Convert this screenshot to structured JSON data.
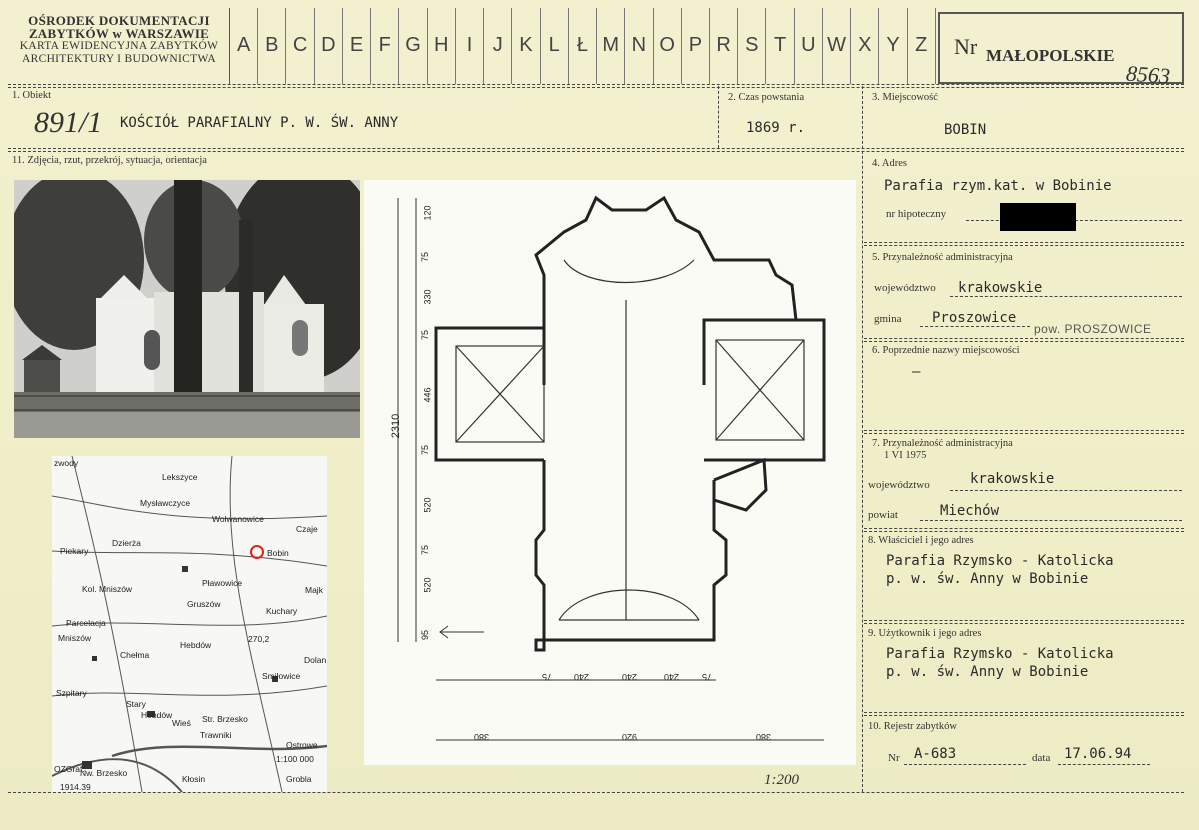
{
  "header": {
    "org_line1": "OŚRODEK DOKUMENTACJI",
    "org_line2": "ZABYTKÓW w WARSZAWIE",
    "org_line3": "KARTA EWIDENCYJNA ZABYTKÓW",
    "org_line4": "ARCHITEKTURY I BUDOWNICTWA",
    "letters": [
      "A",
      "B",
      "C",
      "D",
      "E",
      "F",
      "G",
      "H",
      "I",
      "J",
      "K",
      "L",
      "Ł",
      "M",
      "N",
      "O",
      "P",
      "R",
      "S",
      "T",
      "U",
      "W",
      "X",
      "Y",
      "Z"
    ],
    "nr_label": "Nr",
    "nr_region": "MAŁOPOLSKIE",
    "nr_number": "8563"
  },
  "fields": {
    "obiekt_label": "1. Obiekt",
    "obiekt_hand": "891/1",
    "obiekt_value": "KOŚCIÓŁ PARAFIALNY P. W. ŚW. ANNY",
    "czas_label": "2. Czas powstania",
    "czas_value": "1869 r.",
    "miejscowosc_label": "3. Miejscowość",
    "miejscowosc_value": "BOBIN",
    "zdjecia_label": "11. Zdjęcia, rzut, przekrój, sytuacja, orientacja",
    "adres_label": "4. Adres",
    "adres_value": "Parafia rzym.kat. w Bobinie",
    "nr_hipoteczny_label": "nr hipoteczny",
    "przynaleznosc_label": "5. Przynależność administracyjna",
    "wojewodztwo_label": "województwo",
    "wojewodztwo_value": "krakowskie",
    "gmina_label": "gmina",
    "gmina_value": "Proszowice",
    "gmina_note": "pow. PROSZOWICE",
    "poprzednie_label": "6. Poprzednie nazwy miejscowości",
    "poprzednie_value": "–",
    "przynaleznosc2_label": "7. Przynależność administracyjna",
    "przynaleznosc2_date": "1 VI 1975",
    "wojewodztwo2_label": "województwo",
    "wojewodztwo2_value": "krakowskie",
    "powiat_label": "powiat",
    "powiat_value": "Miechów",
    "wlasciciel_label": "8. Właściciel i jego adres",
    "wlasciciel_value1": "Parafia Rzymsko - Katolicka",
    "wlasciciel_value2": "p. w. św. Anny w Bobinie",
    "uzytkownik_label": "9. Użytkownik i jego adres",
    "uzytkownik_value1": "Parafia Rzymsko - Katolicka",
    "uzytkownik_value2": "p. w. św. Anny w Bobinie",
    "rejestr_label": "10. Rejestr zabytków",
    "rejestr_nr_label": "Nr",
    "rejestr_nr_value": "A-683",
    "rejestr_data_label": "data",
    "rejestr_data_value": "17.06.94",
    "scale": "1:200"
  },
  "map": {
    "labels": [
      "zwody",
      "Lekszyce",
      "Mysławczyce",
      "Wolwanowice",
      "Czaje",
      "Piekary",
      "Dzierża",
      "Bobin",
      "Kol. Mniszów",
      "Pławowice",
      "Gruszów",
      "Kuchary",
      "Majk",
      "Parcelacja",
      "Mniszów",
      "Chełma",
      "Hebdów",
      "Dolan",
      "Szpitary",
      "Stary",
      "Smiłowice",
      "Hebdów",
      "Wieś",
      "Str. Brzesko",
      "Trawniki",
      "Ostrowe",
      "Nw. Brzesko",
      "Kłosin",
      "Grobla",
      "OZGraf.",
      "1914.39",
      "1:100 000",
      "270,2"
    ]
  },
  "plan": {
    "dims_left": [
      "120",
      "75",
      "330",
      "75",
      "446",
      "75",
      "520",
      "75",
      "520",
      "95"
    ],
    "dim_total": "2310",
    "dims_bottom_inner": [
      "75",
      "240",
      "240",
      "240",
      "75"
    ],
    "dims_bottom_outer": [
      "380",
      "920",
      "380"
    ]
  }
}
